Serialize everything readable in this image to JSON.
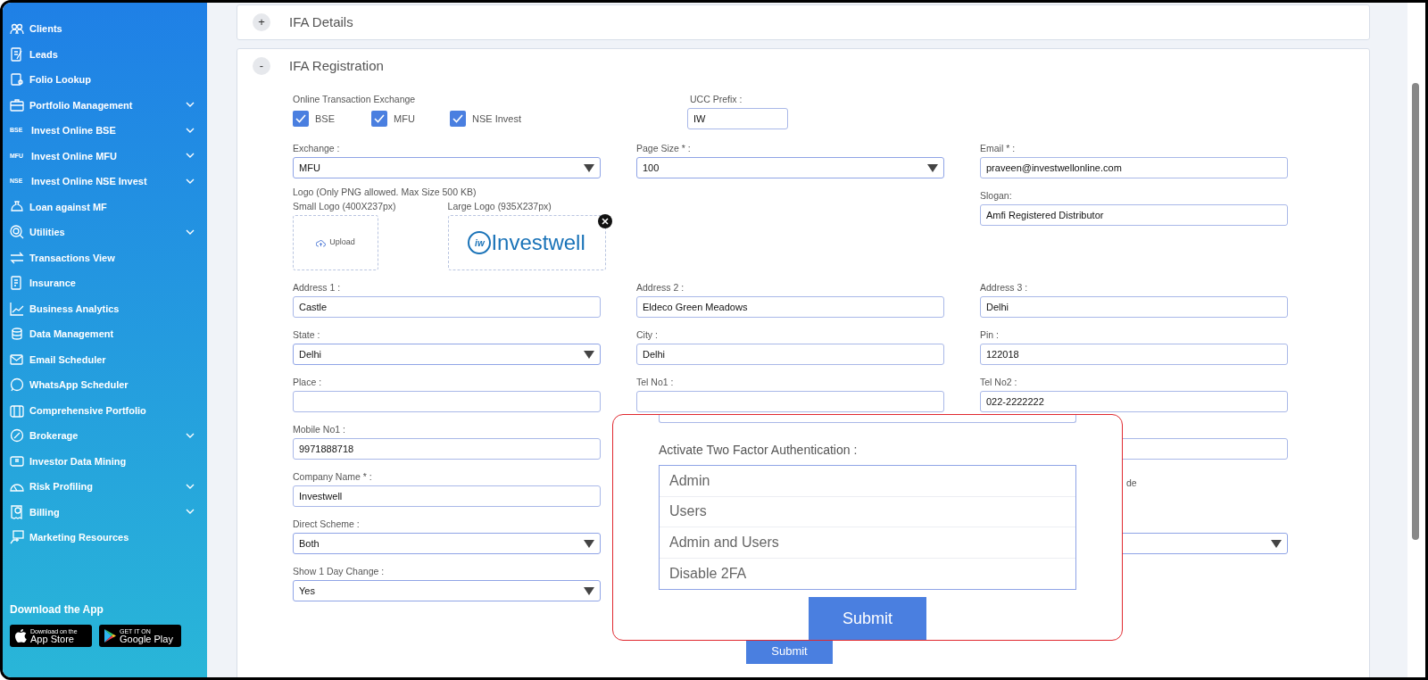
{
  "sidebar": {
    "items": [
      {
        "label": "Clients",
        "expandable": false
      },
      {
        "label": "Leads",
        "expandable": false
      },
      {
        "label": "Folio Lookup",
        "expandable": false
      },
      {
        "label": "Portfolio Management",
        "expandable": true
      },
      {
        "label": "Invest Online BSE",
        "badge": "BSE",
        "expandable": true
      },
      {
        "label": "Invest Online MFU",
        "badge": "MFU",
        "expandable": true
      },
      {
        "label": "Invest Online NSE Invest",
        "badge": "NSE",
        "expandable": true
      },
      {
        "label": "Loan against MF",
        "expandable": false
      },
      {
        "label": "Utilities",
        "expandable": true
      },
      {
        "label": "Transactions View",
        "expandable": false
      },
      {
        "label": "Insurance",
        "expandable": false
      },
      {
        "label": "Business Analytics",
        "expandable": false
      },
      {
        "label": "Data Management",
        "expandable": false
      },
      {
        "label": "Email Scheduler",
        "expandable": false
      },
      {
        "label": "WhatsApp Scheduler",
        "expandable": false
      },
      {
        "label": "Comprehensive Portfolio",
        "expandable": false
      },
      {
        "label": "Brokerage",
        "expandable": true
      },
      {
        "label": "Investor Data Mining",
        "expandable": false
      },
      {
        "label": "Risk Profiling",
        "expandable": true
      },
      {
        "label": "Billing",
        "expandable": true
      },
      {
        "label": "Marketing Resources",
        "expandable": false
      }
    ],
    "download": {
      "title": "Download the App",
      "stores": [
        {
          "kind": "apple",
          "small": "Download on the",
          "big": "App Store"
        },
        {
          "kind": "google",
          "small": "GET IT ON",
          "big": "Google Play"
        }
      ]
    }
  },
  "panels": [
    {
      "toggle": "+",
      "title": "IFA Details",
      "expanded": false
    },
    {
      "toggle": "-",
      "title": "IFA Registration",
      "expanded": true
    }
  ],
  "form": {
    "exchange_group": {
      "label": "Online Transaction Exchange",
      "options": [
        {
          "label": "BSE",
          "checked": true
        },
        {
          "label": "MFU",
          "checked": true
        },
        {
          "label": "NSE Invest",
          "checked": true
        }
      ]
    },
    "ucc_prefix": {
      "label": "UCC Prefix :",
      "value": "IW"
    },
    "rows": [
      {
        "left": [
          {
            "kind": "select",
            "label": "Exchange :",
            "value": "MFU"
          },
          {
            "kind": "logos",
            "note": "Logo (Only PNG allowed. Max Size 500 KB)",
            "small_label": "Small Logo (400X237px)",
            "upload": "Upload",
            "large_label": "Large Logo (935X237px)",
            "logo_mark": "iw",
            "logo_text": "Investwell"
          }
        ],
        "middle": [
          {
            "kind": "select",
            "label": "Page Size * :",
            "value": "100"
          }
        ],
        "right": [
          {
            "kind": "input",
            "label": "Email * :",
            "value": "praveen@investwellonline.com"
          },
          {
            "kind": "input",
            "label": "Slogan:",
            "value": "Amfi Registered Distributor"
          }
        ]
      },
      {
        "left": [
          {
            "kind": "input",
            "label": "Address 1 :",
            "value": "Castle"
          }
        ],
        "middle": [
          {
            "kind": "input",
            "label": "Address 2 :",
            "value": "Eldeco Green Meadows"
          }
        ],
        "right": [
          {
            "kind": "input",
            "label": "Address 3 :",
            "value": "Delhi"
          }
        ]
      },
      {
        "left": [
          {
            "kind": "select",
            "label": "State :",
            "value": "Delhi"
          }
        ],
        "middle": [
          {
            "kind": "input",
            "label": "City :",
            "value": "Delhi"
          }
        ],
        "right": [
          {
            "kind": "input",
            "label": "Pin :",
            "value": "122018"
          }
        ]
      },
      {
        "left": [
          {
            "kind": "input",
            "label": "Place :"
          }
        ],
        "middle": [
          {
            "kind": "input",
            "label": "Tel No1 :"
          }
        ],
        "right": [
          {
            "kind": "input",
            "label": "Tel No2 :",
            "value": "022-2222222"
          }
        ]
      },
      {
        "left": [
          {
            "kind": "input",
            "label": "Mobile No1 :",
            "value": "9971888718"
          }
        ],
        "right": [
          {
            "kind": "input"
          }
        ]
      },
      {
        "left": [
          {
            "kind": "input",
            "label": "Company Name * :",
            "value": "Investwell"
          }
        ],
        "right": [
          {
            "kind": "text",
            "text": "de"
          }
        ]
      },
      {
        "left": [
          {
            "kind": "select",
            "label": "Direct Scheme :",
            "value": "Both"
          }
        ],
        "right": [
          {
            "kind": "select"
          }
        ]
      },
      {
        "left": [
          {
            "kind": "select",
            "label": "Show 1 Day Change :",
            "value": "Yes"
          }
        ]
      }
    ],
    "submit": "Submit"
  },
  "callout": {
    "label": "Activate Two Factor Authentication :",
    "options": [
      {
        "label": "Admin",
        "selected": false
      },
      {
        "label": "Users",
        "selected": false
      },
      {
        "label": "Admin and Users",
        "selected": false
      },
      {
        "label": "Disable 2FA",
        "selected": false
      }
    ],
    "submit": "Submit"
  }
}
